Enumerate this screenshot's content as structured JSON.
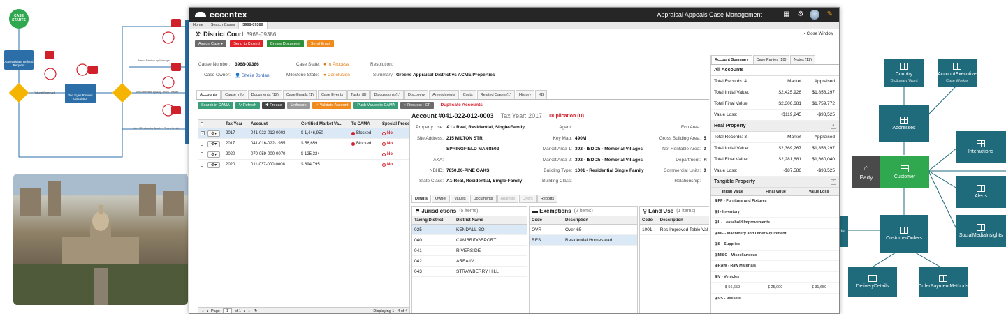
{
  "flow": {
    "start_label": "CASE STARTS",
    "node1_label": "AutoValidate Refund Request",
    "node2_label": "2nd Eyes Review Calculator",
    "edges": [
      "Refund Approved",
      "Need Review by Manager",
      "Need Review by Any Team Leader",
      "Need Review by Another Team Leader"
    ]
  },
  "erd": {
    "country": {
      "title": "Country",
      "sub": "Dictionary Word"
    },
    "account_exec": {
      "title": "AccountExecutive",
      "sub": "Case Worker"
    },
    "addresses": "Addresses",
    "interactions": "Interactions",
    "party": "Party",
    "customer": "Customer",
    "alerts": "Alerts",
    "social": "SocialMediaInsights",
    "orders": "CustomerOrders",
    "delivery": "DeliveryDetails",
    "payment": "OrderPaymentMethods",
    "partial_left": "rder"
  },
  "app": {
    "brand": "eccentex",
    "title": "Appraisal Appeals Case Management",
    "colors": {
      "topbar": "#262626",
      "red": "#e0242b",
      "green": "#2f8f3a",
      "orange": "#f08a1c",
      "selected_row": "#dbe9f7"
    },
    "breadcrumbs": [
      "Home",
      "Search Cases",
      "3968-09386"
    ],
    "header": {
      "title": "District Court",
      "number": "3968-09386",
      "close": "Close Window"
    },
    "buttons": {
      "assign": "Assign Case",
      "close": "Send to Closed",
      "create_doc": "Create Document",
      "send_email": "Send Email"
    },
    "fields": {
      "case_number_label": "Cause Number:",
      "case_number": "3968-09386",
      "case_state_label": "Case State:",
      "case_state": "In Process",
      "resolution_label": "Resolution:",
      "owner_label": "Case Owner:",
      "owner": "Sheila Jordan",
      "milestone_label": "Milestone State:",
      "milestone": "Conclusion",
      "summary_label": "Summary:",
      "summary": "Greene Appraisal District vs ACME Properties"
    },
    "tabs": [
      "Accounts",
      "Cause Info",
      "Documents (12)",
      "Case Emails (1)",
      "Case Events",
      "Tasks (9)",
      "Discussions (1)",
      "Discovery",
      "Amendments",
      "Costs",
      "Related Cases (1)",
      "History",
      "KB"
    ],
    "actions": {
      "search": "Search in CAMA",
      "refresh": "Refresh",
      "freeze": "Freeze",
      "unfreeze": "Unfreeze",
      "validate": "Validate Account",
      "push": "Push Values to CAMA",
      "hep": "Request HEP",
      "dup": "Duplicate Accounts"
    },
    "grid": {
      "headers": [
        "Tax Year",
        "Account",
        "Certified Market Va...",
        "To CAMA",
        "Special Proce..."
      ],
      "rows": [
        {
          "year": "2017",
          "account": "041-022-012-0003",
          "value": "$ 1,446,950",
          "cama": "Blocked",
          "special": "No",
          "checked": "✓"
        },
        {
          "year": "2017",
          "account": "041-016-022-1955",
          "value": "$ 56,659",
          "cama": "Blocked",
          "special": "No",
          "checked": ""
        },
        {
          "year": "2020",
          "account": "070-059-000-0070",
          "value": "$ 125,324",
          "cama": "",
          "special": "No",
          "checked": ""
        },
        {
          "year": "2020",
          "account": "011-037-000-0008",
          "value": "$ 894,795",
          "cama": "",
          "special": "No",
          "checked": ""
        }
      ],
      "page_label": "Page",
      "page": "1",
      "of": "of 1",
      "displaying": "Displaying 1 - 4 of 4"
    },
    "account": {
      "title": "Account #041-022-012-0003",
      "tax_year": "Tax Year: 2017",
      "dup": "Duplication (D)",
      "property_use_label": "Property Use:",
      "property_use": "A1 - Real, Residential, Single-Family",
      "site_address_label": "Site Address:",
      "site_address1": "215 MILTON STR",
      "site_address2": "SPRINGFIELD MA 68502",
      "aka_label": "AKA:",
      "nbhd_label": "NBHD:",
      "nbhd": "7850.00-PINE OAKS",
      "state_class_label": "State Class:",
      "state_class": "A1-Real, Residential, Single-Family",
      "agent_label": "Agent:",
      "keymap_label": "Key Map:",
      "keymap": "490M",
      "ma1_label": "Market Area 1:",
      "ma1": "392 - ISD 25 - Memorial Villages",
      "ma2_label": "Market Area 2:",
      "ma2": "392 - ISD 25 - Memorial Villages",
      "btype_label": "Building Type:",
      "btype": "1001 - Residential Single Family",
      "bclass_label": "Building Class:",
      "eco_label": "Eco Area:",
      "gba_label": "Gross Building Area:",
      "gba": "5",
      "nra_label": "Net Rentable Area:",
      "nra": "0",
      "dept_label": "Department:",
      "dept": "R",
      "units_label": "Commercial Units:",
      "units": "0",
      "rel_label": "Relationship:"
    },
    "subtabs": [
      "Details",
      "Owner",
      "Values",
      "Documents",
      "Analysis",
      "Offers",
      "Reports"
    ],
    "jurisdictions": {
      "title": "Jurisdictions",
      "count": "(5 items)",
      "col1": "Taxing District",
      "col2": "District Name",
      "rows": [
        [
          "025",
          "KENDALL SQ"
        ],
        [
          "040",
          "CAMBRIDGEPORT"
        ],
        [
          "041",
          "RIVERSIDE"
        ],
        [
          "042",
          "AREA IV"
        ],
        [
          "043",
          "STRAWBERRY HILL"
        ]
      ]
    },
    "exemptions": {
      "title": "Exemptions",
      "count": "(2 items)",
      "col1": "Code",
      "col2": "Description",
      "rows": [
        [
          "OVR",
          "Over-65"
        ],
        [
          "RES",
          "Residential Homestead"
        ]
      ]
    },
    "landuse": {
      "title": "Land Use",
      "count": "(1 items)",
      "col1": "Code",
      "col2": "Description",
      "rows": [
        [
          "1001",
          "Res Improved Table Val"
        ]
      ]
    },
    "right": {
      "tabs": [
        "Account Summary",
        "Case Parties (20)",
        "Notes (12)"
      ],
      "all": {
        "title": "All Accounts",
        "records": "Total Records: 4",
        "market": "Market",
        "appraised": "Appraised",
        "rows": [
          [
            "Total Initial Value:",
            "$2,425,926",
            "$1,858,297"
          ],
          [
            "Total Final Value:",
            "$2,306,681",
            "$1,759,772"
          ],
          [
            "Value Loss:",
            "-$119,245",
            "-$98,525"
          ]
        ]
      },
      "real": {
        "title": "Real Property",
        "records": "Total Records: 3",
        "market": "Market",
        "appraised": "Appraised",
        "rows": [
          [
            "Total Initial Value:",
            "$2,369,267",
            "$1,858,297"
          ],
          [
            "Total Final Value:",
            "$2,281,681",
            "$1,660,040"
          ],
          [
            "Value Loss:",
            "-$87,586",
            "-$98,525"
          ]
        ]
      },
      "tangible": {
        "title": "Tangible Property",
        "cols": [
          "Initial Value",
          "Final Value",
          "Value Loss"
        ],
        "rows": [
          "FF - Furniture and Fixtures",
          "I - Inventory",
          "L - Leasehold Improvements",
          "ME - Machinery and Other Equipment",
          "S - Supplies",
          "MISC - Miscellaneous",
          "RAW - Raw Materials",
          "V - Vehicles",
          "VS - Vessels"
        ],
        "vehicle_vals": [
          "$ 56,659",
          "$ 25,000",
          "-$ 31,659"
        ]
      }
    }
  }
}
